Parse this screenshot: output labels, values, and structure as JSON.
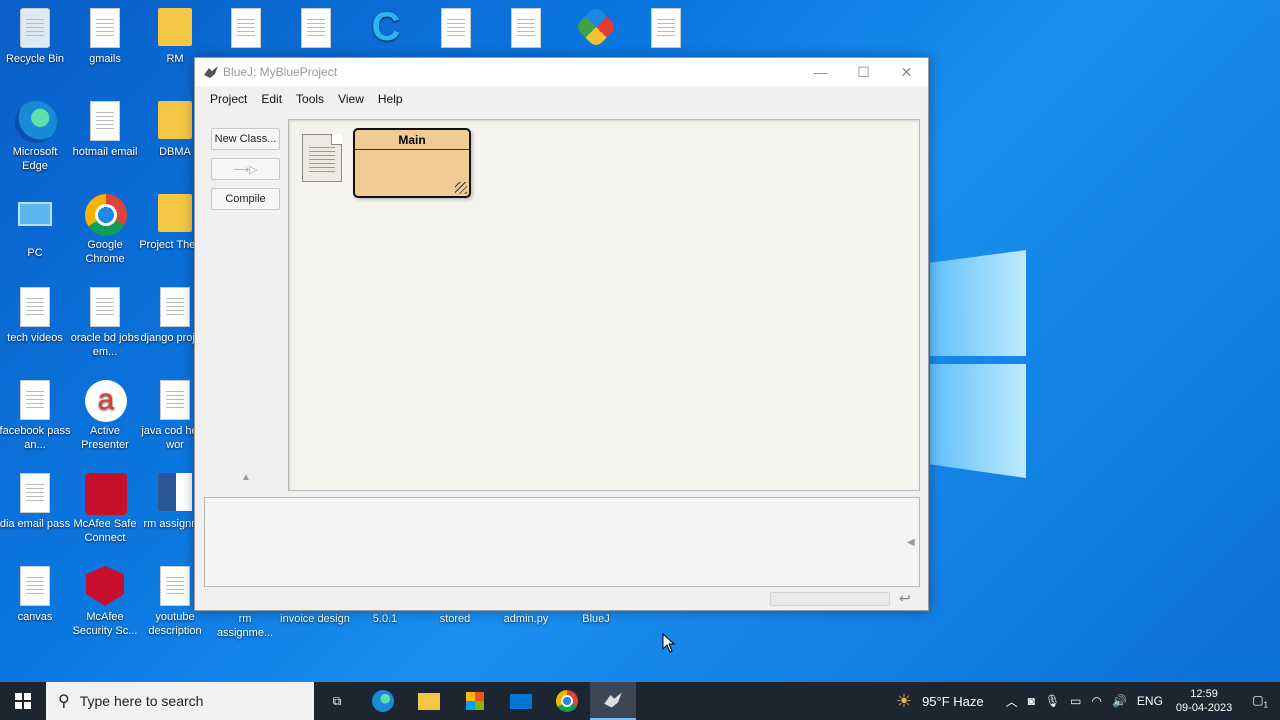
{
  "desktop": {
    "icons": [
      {
        "label": "Recycle Bin",
        "icon": "recycle-bin-icon"
      },
      {
        "label": "gmails",
        "icon": "document-icon"
      },
      {
        "label": "RM",
        "icon": "folder-icon"
      },
      {
        "label": "Microsoft Edge",
        "icon": "edge-icon"
      },
      {
        "label": "hotmail email",
        "icon": "document-icon"
      },
      {
        "label": "DBMA",
        "icon": "folder-icon"
      },
      {
        "label": "PC",
        "icon": "pc-icon"
      },
      {
        "label": "Google Chrome",
        "icon": "chrome-icon"
      },
      {
        "label": "Project Theory",
        "icon": "folder-icon"
      },
      {
        "label": "tech videos",
        "icon": "document-icon"
      },
      {
        "label": "oracle bd jobs em...",
        "icon": "document-icon"
      },
      {
        "label": "django project",
        "icon": "document-icon"
      },
      {
        "label": "facebook pass an...",
        "icon": "document-icon"
      },
      {
        "label": "Active Presenter",
        "icon": "active-presenter-icon"
      },
      {
        "label": "java cod hello wor",
        "icon": "document-icon"
      },
      {
        "label": "dia email pass",
        "icon": "document-icon"
      },
      {
        "label": "McAfee Safe Connect",
        "icon": "mcafee-safe-connect-icon"
      },
      {
        "label": "rm assignme",
        "icon": "word-icon"
      },
      {
        "label": "canvas",
        "icon": "document-icon"
      },
      {
        "label": "McAfee Security Sc...",
        "icon": "mcafee-icon"
      },
      {
        "label": "youtube description",
        "icon": "document-icon"
      },
      {
        "label": "rm assignme...",
        "icon": "document-icon"
      },
      {
        "label": "invoice design",
        "icon": "document-icon"
      },
      {
        "label": "5.0.1",
        "icon": "document-icon"
      },
      {
        "label": "stored",
        "icon": "document-icon"
      },
      {
        "label": "admin.py",
        "icon": "document-icon"
      },
      {
        "label": "BlueJ",
        "icon": "bluej-icon"
      }
    ]
  },
  "window": {
    "title": "BlueJ:  MyBlueProject",
    "menu": [
      "Project",
      "Edit",
      "Tools",
      "View",
      "Help"
    ],
    "sidebar": {
      "new_class": "New Class...",
      "arrow": "⟶▷",
      "compile": "Compile"
    },
    "canvas": {
      "class_name": "Main"
    }
  },
  "taskbar": {
    "search_placeholder": "Type here to search",
    "weather": "95°F  Haze",
    "lang": "ENG",
    "time": "12:59",
    "date": "09-04-2023",
    "notifications": "1"
  }
}
